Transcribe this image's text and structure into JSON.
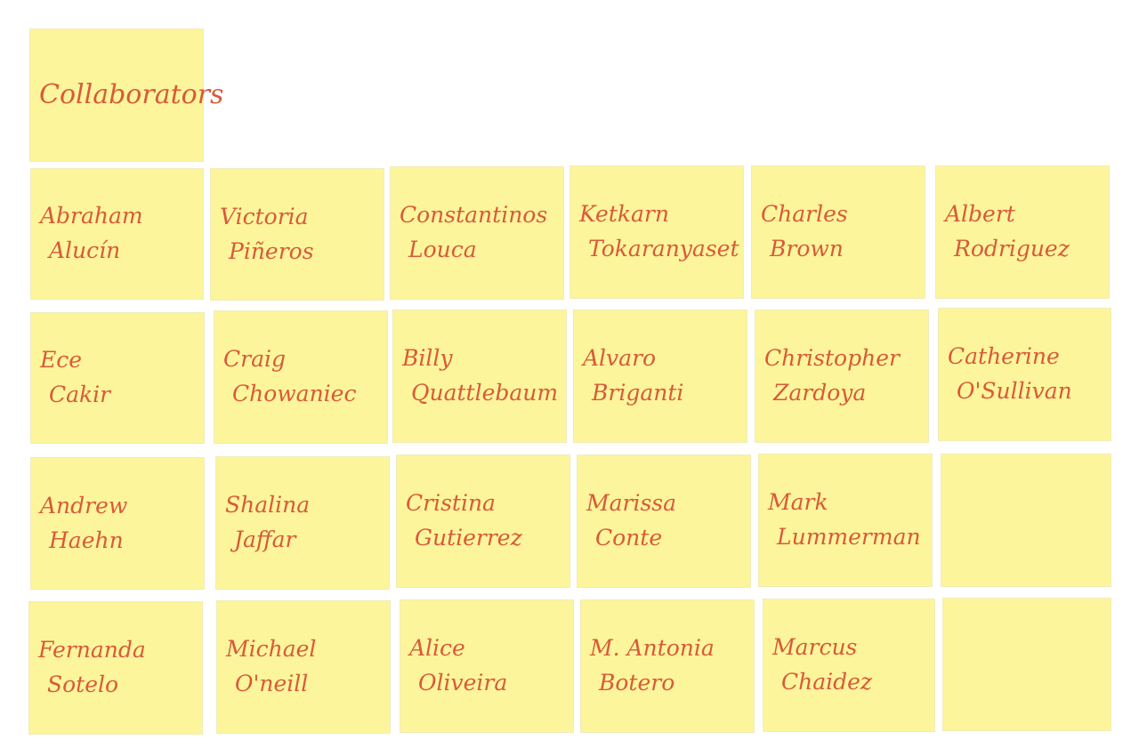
{
  "board": {
    "title": "Collaborators",
    "notes": [
      [
        "Abraham",
        "Alucín"
      ],
      [
        "Victoria",
        "Piñeros"
      ],
      [
        "Constantinos",
        "Louca"
      ],
      [
        "Ketkarn",
        "Tokaranyaset"
      ],
      [
        "Charles",
        "Brown"
      ],
      [
        "Albert",
        "Rodriguez"
      ],
      [
        "Ece",
        "Cakir"
      ],
      [
        "Craig",
        "Chowaniec"
      ],
      [
        "Billy",
        "Quattlebaum"
      ],
      [
        "Alvaro",
        "Briganti"
      ],
      [
        "Christopher",
        "Zardoya"
      ],
      [
        "Catherine",
        "O'Sullivan"
      ],
      [
        "Andrew",
        "Haehn"
      ],
      [
        "Shalina",
        "Jaffar"
      ],
      [
        "Cristina",
        "Gutierrez"
      ],
      [
        "Marissa",
        "Conte"
      ],
      [
        "Mark",
        "Lummerman"
      ],
      [
        "",
        ""
      ],
      [
        "Fernanda",
        "Sotelo"
      ],
      [
        "Michael",
        "O'neill"
      ],
      [
        "Alice",
        "Oliveira"
      ],
      [
        "M. Antonia",
        "Botero"
      ],
      [
        "Marcus",
        "Chaidez"
      ],
      [
        "",
        ""
      ]
    ]
  }
}
